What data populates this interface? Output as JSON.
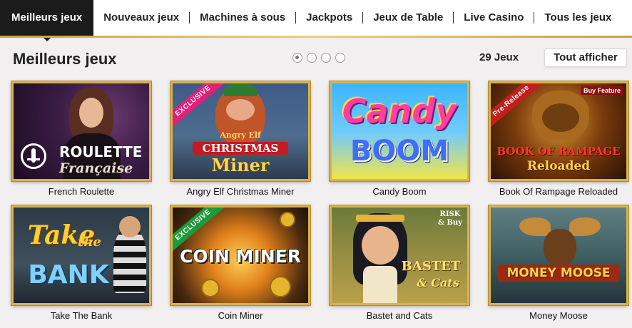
{
  "nav": {
    "items": [
      {
        "label": "Meilleurs jeux",
        "active": true
      },
      {
        "label": "Nouveaux jeux"
      },
      {
        "label": "Machines à sous"
      },
      {
        "label": "Jackpots"
      },
      {
        "label": "Jeux de Table"
      },
      {
        "label": "Live Casino"
      },
      {
        "label": "Tous les jeux"
      }
    ]
  },
  "section": {
    "title": "Meilleurs jeux",
    "count": "29 Jeux",
    "show_all": "Tout afficher",
    "pagination": {
      "pages": 4,
      "current": 1
    }
  },
  "games": [
    {
      "name": "French Roulette",
      "art": {
        "line1": "ROULETTE",
        "line2": "Française"
      }
    },
    {
      "name": "Angry Elf Christmas Miner",
      "art": {
        "ribbon": "EXCLUSIVE",
        "small": "Angry Elf",
        "line1": "CHRISTMAS",
        "line2": "Miner"
      }
    },
    {
      "name": "Candy Boom",
      "art": {
        "line1": "Candy",
        "line2": "BOOM"
      }
    },
    {
      "name": "Book Of Rampage Reloaded",
      "art": {
        "ribbon": "Pre-Release",
        "badge": "Buy Feature",
        "line1": "BOOK OF RAMPAGE",
        "line2": "Reloaded"
      }
    },
    {
      "name": "Take The Bank",
      "art": {
        "line1": "Take",
        "small": "the",
        "line2": "BANK"
      }
    },
    {
      "name": "Coin Miner",
      "art": {
        "ribbon": "EXCLUSIVE",
        "line1": "COIN MINER"
      }
    },
    {
      "name": "Bastet and Cats",
      "art": {
        "badge": "RISK & Buy",
        "line1": "BASTET",
        "line2": "& Cats"
      }
    },
    {
      "name": "Money Moose",
      "art": {
        "line1": "MONEY MOOSE"
      }
    }
  ],
  "colors": {
    "nav_active_bg": "#1b1b1b",
    "gold_border": "#d9b24f",
    "page_bg": "#f1efef"
  }
}
